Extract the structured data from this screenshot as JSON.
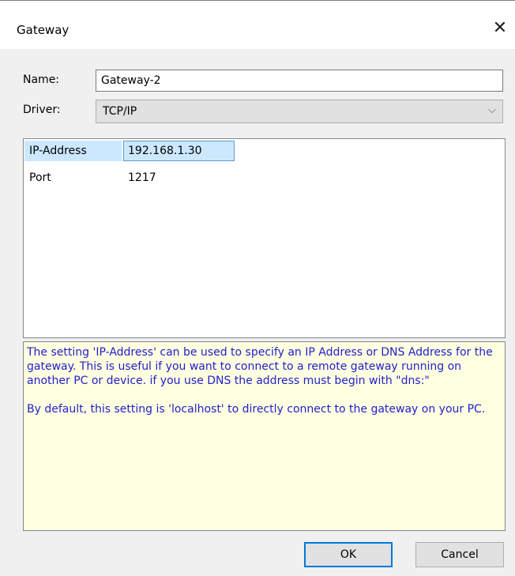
{
  "window": {
    "title": "Gateway",
    "close_glyph": "✕"
  },
  "form": {
    "name_label": "Name:",
    "name_value": "Gateway-2",
    "driver_label": "Driver:",
    "driver_value": "TCP/IP",
    "driver_chevron": "⌵"
  },
  "properties": [
    {
      "name": "IP-Address",
      "value": "192.168.1.30"
    },
    {
      "name": "Port",
      "value": "1217"
    }
  ],
  "help": {
    "paragraph1": "The setting 'IP-Address' can be used to specify an IP Address or DNS Address for the gateway. This is useful if you want to connect to a remote gateway running on another PC or device. if you use DNS the address must begin with \"dns:\"",
    "paragraph2": "By default, this setting is 'localhost' to directly connect to the gateway on your PC."
  },
  "buttons": {
    "ok": "OK",
    "cancel": "Cancel"
  }
}
